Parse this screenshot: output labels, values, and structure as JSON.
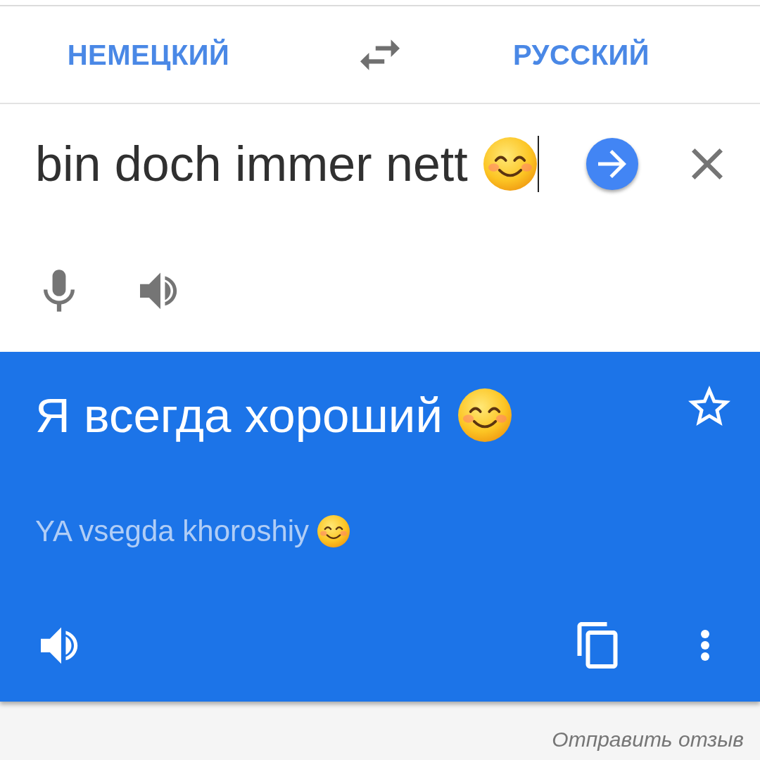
{
  "language_bar": {
    "source_language": "НЕМЕЦКИЙ",
    "target_language": "РУССКИЙ"
  },
  "input": {
    "value": "bin doch immer nett",
    "focused": true
  },
  "translation": {
    "text": "Я всегда хороший",
    "transliteration": "YA vsegda khoroshiy",
    "starred": false
  },
  "footer": {
    "feedback_link": "Отправить отзыв"
  }
}
